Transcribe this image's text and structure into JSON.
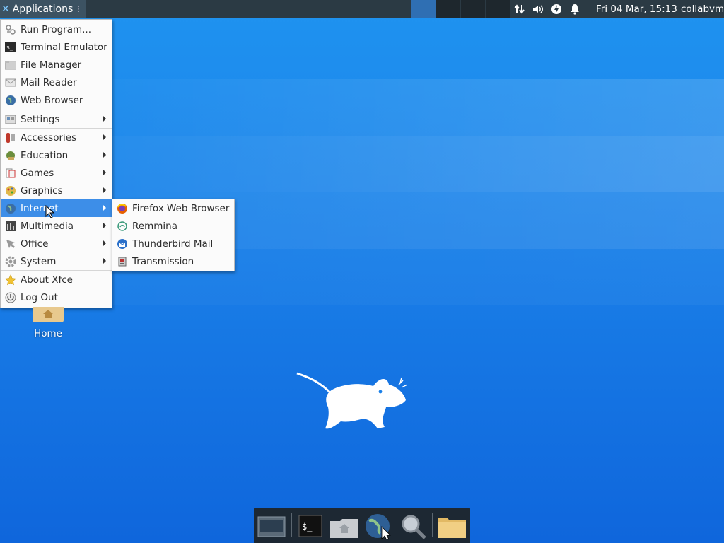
{
  "top_panel": {
    "applications_label": "Applications",
    "clock": "Fri 04 Mar, 15:13",
    "user": "collabvm",
    "tray_icons": [
      "network-icon",
      "volume-icon",
      "power-icon",
      "notification-icon"
    ]
  },
  "main_menu": {
    "items": [
      {
        "label": "Run Program...",
        "icon": "run-program-icon"
      },
      {
        "label": "Terminal Emulator",
        "icon": "terminal-icon"
      },
      {
        "label": "File Manager",
        "icon": "file-manager-icon"
      },
      {
        "label": "Mail Reader",
        "icon": "mail-icon"
      },
      {
        "label": "Web Browser",
        "icon": "web-browser-icon"
      },
      {
        "label": "Settings",
        "icon": "settings-icon"
      },
      {
        "label": "Accessories",
        "icon": "accessories-icon"
      },
      {
        "label": "Education",
        "icon": "education-icon"
      },
      {
        "label": "Games",
        "icon": "games-icon"
      },
      {
        "label": "Graphics",
        "icon": "graphics-icon"
      },
      {
        "label": "Internet",
        "icon": "internet-icon"
      },
      {
        "label": "Multimedia",
        "icon": "multimedia-icon"
      },
      {
        "label": "Office",
        "icon": "office-icon"
      },
      {
        "label": "System",
        "icon": "system-icon"
      },
      {
        "label": "About Xfce",
        "icon": "star-icon"
      },
      {
        "label": "Log Out",
        "icon": "logout-icon"
      }
    ]
  },
  "internet_submenu": {
    "items": [
      {
        "label": "Firefox Web Browser",
        "icon": "firefox-icon"
      },
      {
        "label": "Remmina",
        "icon": "remmina-icon"
      },
      {
        "label": "Thunderbird Mail",
        "icon": "thunderbird-icon"
      },
      {
        "label": "Transmission",
        "icon": "transmission-icon"
      }
    ]
  },
  "desktop": {
    "home_label": "Home"
  },
  "dock": {
    "items": [
      "show-desktop-icon",
      "terminal-icon",
      "home-folder-icon",
      "web-browser-icon",
      "search-icon",
      "folder-icon"
    ]
  }
}
